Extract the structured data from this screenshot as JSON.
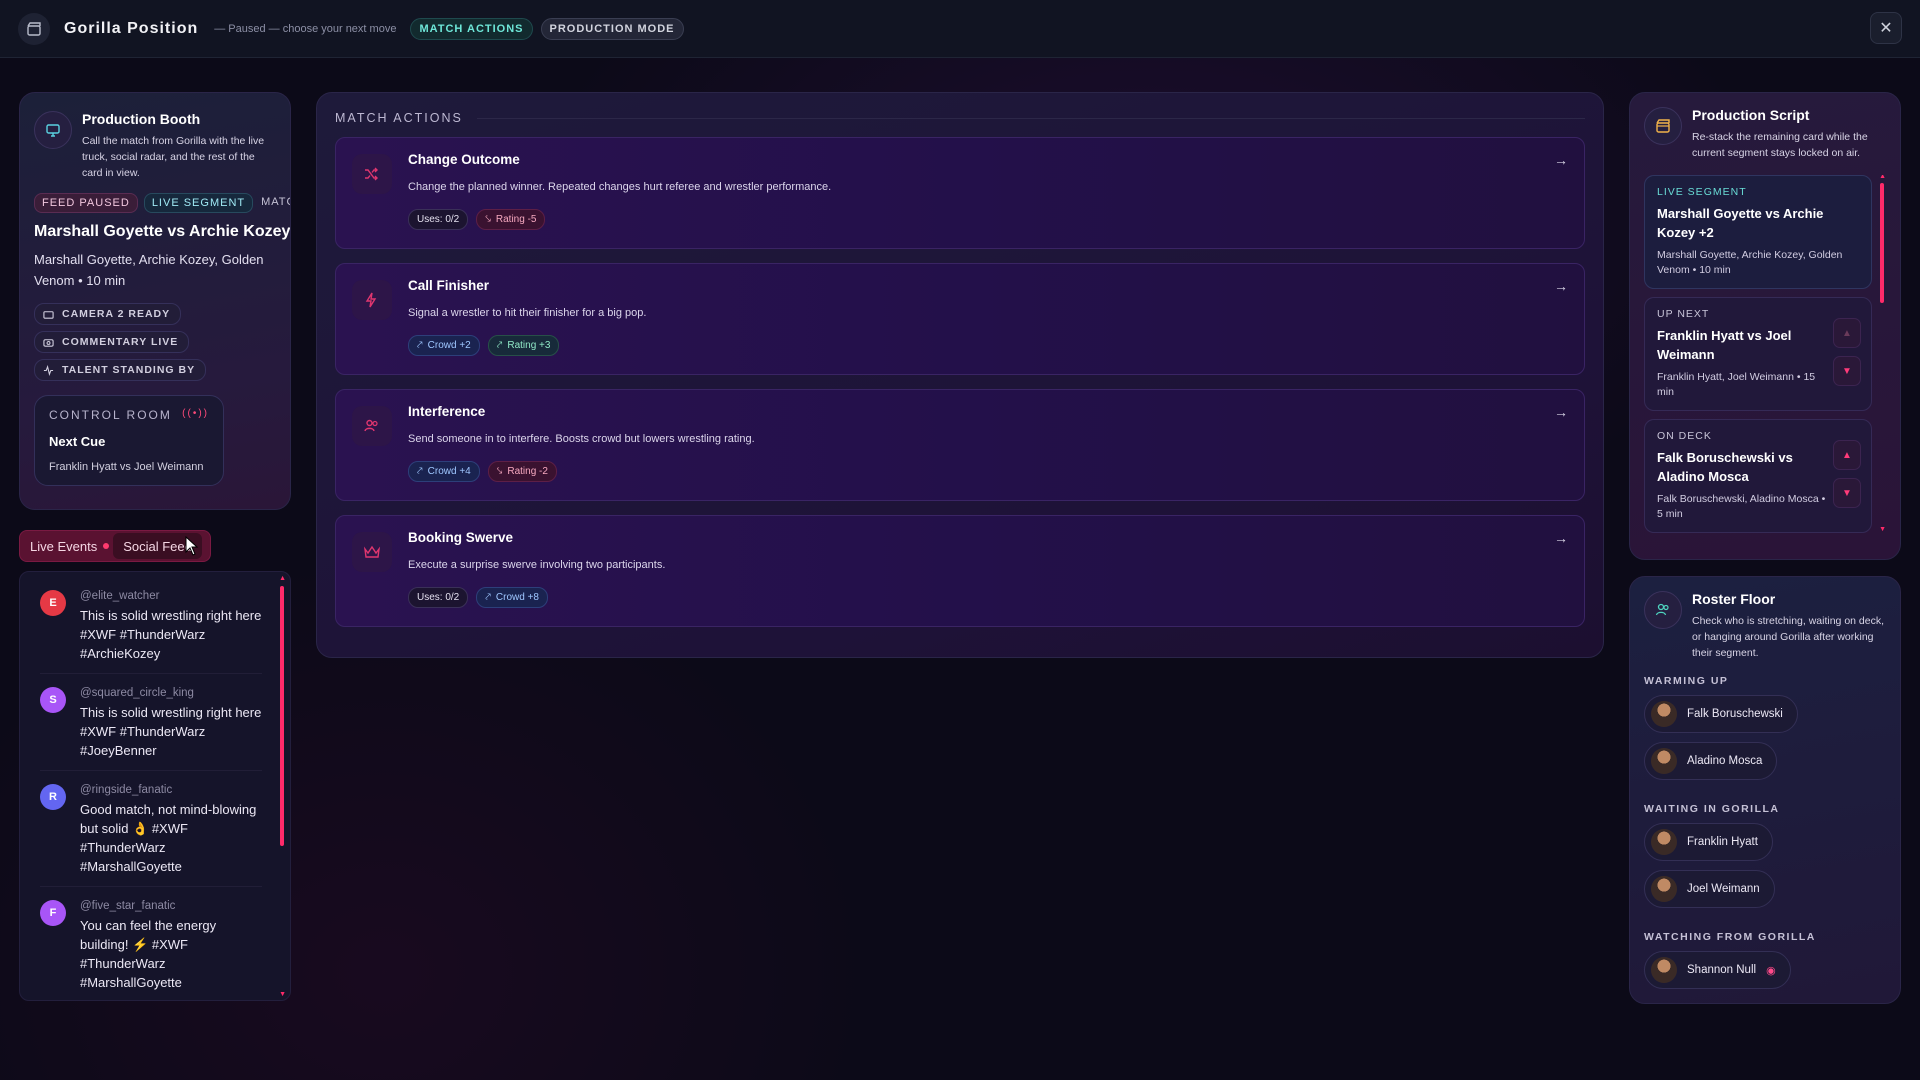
{
  "topbar": {
    "title": "Gorilla Position",
    "subtitle": "— Paused — choose your next move",
    "pill_actions": "MATCH ACTIONS",
    "pill_mode": "PRODUCTION MODE",
    "close": "✕"
  },
  "booth": {
    "title": "Production Booth",
    "desc": "Call the match from Gorilla with the live truck, social radar, and the rest of the card in view.",
    "tags": [
      "FEED PAUSED",
      "LIVE SEGMENT",
      "MATC"
    ],
    "match": "Marshall Goyette vs Archie Kozey +",
    "match_sub": "Marshall Goyette, Archie Kozey, Golden Venom • 10 min",
    "status": [
      "CAMERA 2 READY",
      "COMMENTARY LIVE",
      "TALENT STANDING BY"
    ],
    "control_room": {
      "label": "CONTROL ROOM",
      "title": "Next Cue",
      "sub": "Franklin Hyatt vs Joel Weimann"
    }
  },
  "feed_tabs": {
    "live": "Live Events",
    "social": "Social Feed"
  },
  "feed": [
    {
      "initial": "E",
      "color": "#e53945",
      "handle": "@elite_watcher",
      "text": "This is solid wrestling right here #XWF #ThunderWarz #ArchieKozey"
    },
    {
      "initial": "S",
      "color": "#a855f7",
      "handle": "@squared_circle_king",
      "text": "This is solid wrestling right here #XWF #ThunderWarz #JoeyBenner"
    },
    {
      "initial": "R",
      "color": "#6366f1",
      "handle": "@ringside_fanatic",
      "text": "Good match, not mind-blowing but solid 👌 #XWF #ThunderWarz #MarshallGoyette"
    },
    {
      "initial": "F",
      "color": "#a855f7",
      "handle": "@five_star_fanatic",
      "text": "You can feel the energy building! ⚡ #XWF #ThunderWarz #MarshallGoyette"
    }
  ],
  "actions": {
    "label": "MATCH ACTIONS",
    "items": [
      {
        "title": "Change Outcome",
        "desc": "Change the planned winner. Repeated changes hurt referee and wrestler performance.",
        "icon": "shuffle-icon",
        "chips": [
          {
            "text": "Uses: 0/2",
            "kind": "neutral"
          },
          {
            "text": "Rating -5",
            "kind": "red"
          }
        ]
      },
      {
        "title": "Call Finisher",
        "desc": "Signal a wrestler to hit their finisher for a big pop.",
        "icon": "lightning-icon",
        "chips": [
          {
            "text": "Crowd +2",
            "kind": "blue"
          },
          {
            "text": "Rating +3",
            "kind": "green"
          }
        ]
      },
      {
        "title": "Interference",
        "desc": "Send someone in to interfere. Boosts crowd but lowers wrestling rating.",
        "icon": "users-icon",
        "chips": [
          {
            "text": "Crowd +4",
            "kind": "blue"
          },
          {
            "text": "Rating -2",
            "kind": "red"
          }
        ]
      },
      {
        "title": "Booking Swerve",
        "desc": "Execute a surprise swerve involving two participants.",
        "icon": "crown-icon",
        "chips": [
          {
            "text": "Uses: 0/2",
            "kind": "neutral"
          },
          {
            "text": "Crowd +8",
            "kind": "blue"
          }
        ]
      }
    ]
  },
  "script": {
    "title": "Production Script",
    "desc": "Re-stack the remaining card while the current segment stays locked on air.",
    "live": {
      "label": "LIVE SEGMENT",
      "title": "Marshall Goyette vs Archie Kozey +2",
      "sub": "Marshall Goyette, Archie Kozey, Golden Venom • 10 min"
    },
    "next": {
      "label": "UP NEXT",
      "title": "Franklin Hyatt vs Joel Weimann",
      "sub": "Franklin Hyatt, Joel Weimann • 15 min"
    },
    "deck": {
      "label": "ON DECK",
      "title": "Falk Boruschewski vs Aladino Mosca",
      "sub": "Falk Boruschewski, Aladino Mosca • 5 min"
    }
  },
  "roster": {
    "title": "Roster Floor",
    "desc": "Check who is stretching, waiting on deck, or hanging around Gorilla after working their segment.",
    "warming_label": "WARMING UP",
    "warming": [
      "Falk Boruschewski",
      "Aladino Mosca"
    ],
    "waiting_label": "WAITING IN GORILLA",
    "waiting": [
      "Franklin Hyatt",
      "Joel Weimann"
    ],
    "watching_label": "WATCHING FROM GORILLA",
    "watching": [
      "Shannon Null"
    ]
  }
}
